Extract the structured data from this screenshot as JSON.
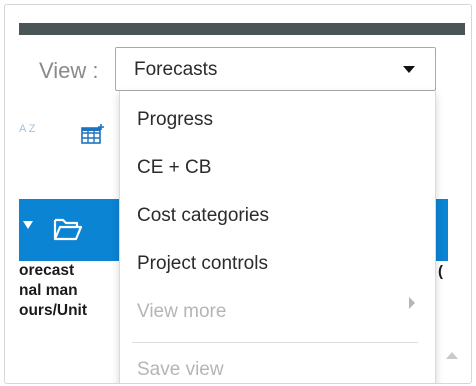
{
  "view": {
    "label": "View :",
    "selected": "Forecasts"
  },
  "toolbar": {
    "sort_icon_text": "A Z"
  },
  "grid": {
    "column_header_lines": [
      "orecast",
      "nal man",
      "ours/Unit"
    ],
    "right_column_fragment": "("
  },
  "menu": {
    "items": [
      {
        "label": "Progress",
        "enabled": true
      },
      {
        "label": "CE + CB",
        "enabled": true
      },
      {
        "label": "Cost categories",
        "enabled": true
      },
      {
        "label": "Project controls",
        "enabled": true
      },
      {
        "label": "View more",
        "enabled": false
      },
      {
        "label": "Save view",
        "enabled": false
      }
    ]
  },
  "colors": {
    "accent": "#0b84d4",
    "topbar": "#4a5656",
    "disabled_text": "#b5b5b5"
  },
  "icons": [
    "sort-az-icon",
    "add-column-grid-icon",
    "folder-open-icon",
    "chevron-down-icon",
    "chevron-right-icon",
    "scroll-up-icon"
  ]
}
